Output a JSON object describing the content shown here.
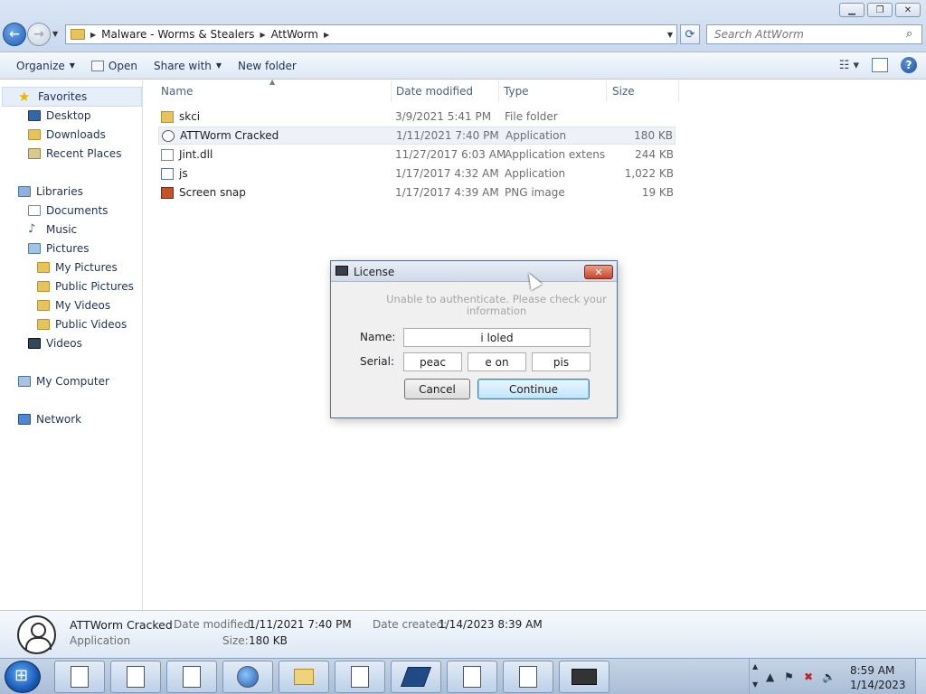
{
  "window": {
    "buttons": [
      "minimize",
      "restore",
      "close"
    ]
  },
  "address": {
    "crumbs": [
      "Malware - Worms & Stealers",
      "AttWorm"
    ],
    "search_placeholder": "Search AttWorm"
  },
  "toolbar": {
    "organize": "Organize",
    "open": "Open",
    "share_with": "Share with",
    "new_folder": "New folder"
  },
  "nav": {
    "favorites": "Favorites",
    "desktop": "Desktop",
    "downloads": "Downloads",
    "recent_places": "Recent Places",
    "libraries": "Libraries",
    "documents": "Documents",
    "music": "Music",
    "pictures": "Pictures",
    "my_pictures": "My Pictures",
    "public_pictures": "Public Pictures",
    "my_videos": "My Videos",
    "public_videos": "Public Videos",
    "videos": "Videos",
    "my_computer": "My Computer",
    "network": "Network"
  },
  "columns": {
    "name": "Name",
    "date_modified": "Date modified",
    "type": "Type",
    "size": "Size"
  },
  "files": [
    {
      "name": "skci",
      "date": "3/9/2021 5:41 PM",
      "type": "File folder",
      "size": "",
      "icon": "folder-icon"
    },
    {
      "name": "ATTWorm Cracked",
      "date": "1/11/2021 7:40 PM",
      "type": "Application",
      "size": "180 KB",
      "icon": "app-icon"
    },
    {
      "name": "Jint.dll",
      "date": "11/27/2017 6:03 AM",
      "type": "Application extens...",
      "size": "244 KB",
      "icon": "dll-icon"
    },
    {
      "name": "js",
      "date": "1/17/2017 4:32 AM",
      "type": "Application",
      "size": "1,022 KB",
      "icon": "exe-icon"
    },
    {
      "name": "Screen snap",
      "date": "1/17/2017 4:39 AM",
      "type": "PNG image",
      "size": "19 KB",
      "icon": "png-icon"
    }
  ],
  "details": {
    "name": "ATTWorm Cracked",
    "type": "Application",
    "date_modified_label": "Date modified:",
    "date_modified": "1/11/2021 7:40 PM",
    "size_label": "Size:",
    "size": "180 KB",
    "date_created_label": "Date created:",
    "date_created": "1/14/2023 8:39 AM"
  },
  "dialog": {
    "title": "License",
    "message": "Unable to authenticate. Please check your information",
    "name_label": "Name:",
    "name_value": "i loled",
    "serial_label": "Serial:",
    "serial_1": "peac",
    "serial_2": "e on",
    "serial_3": "pis",
    "cancel": "Cancel",
    "continue": "Continue"
  },
  "clock": {
    "time": "8:59 AM",
    "date": "1/14/2023"
  }
}
